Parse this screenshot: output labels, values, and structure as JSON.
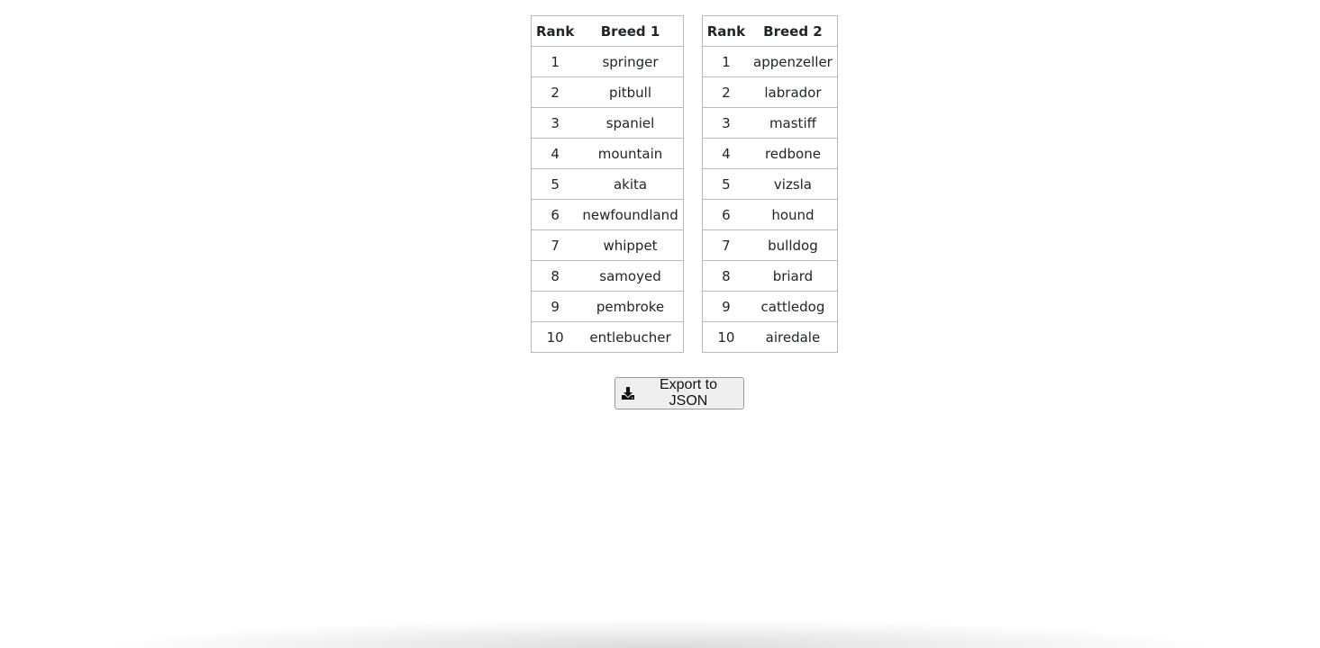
{
  "table1": {
    "headers": {
      "rank": "Rank",
      "breed": "Breed 1"
    },
    "rows": [
      {
        "rank": "1",
        "breed": "springer"
      },
      {
        "rank": "2",
        "breed": "pitbull"
      },
      {
        "rank": "3",
        "breed": "spaniel"
      },
      {
        "rank": "4",
        "breed": "mountain"
      },
      {
        "rank": "5",
        "breed": "akita"
      },
      {
        "rank": "6",
        "breed": "newfoundland"
      },
      {
        "rank": "7",
        "breed": "whippet"
      },
      {
        "rank": "8",
        "breed": "samoyed"
      },
      {
        "rank": "9",
        "breed": "pembroke"
      },
      {
        "rank": "10",
        "breed": "entlebucher"
      }
    ]
  },
  "table2": {
    "headers": {
      "rank": "Rank",
      "breed": "Breed 2"
    },
    "rows": [
      {
        "rank": "1",
        "breed": "appenzeller"
      },
      {
        "rank": "2",
        "breed": "labrador"
      },
      {
        "rank": "3",
        "breed": "mastiff"
      },
      {
        "rank": "4",
        "breed": "redbone"
      },
      {
        "rank": "5",
        "breed": "vizsla"
      },
      {
        "rank": "6",
        "breed": "hound"
      },
      {
        "rank": "7",
        "breed": "bulldog"
      },
      {
        "rank": "8",
        "breed": "briard"
      },
      {
        "rank": "9",
        "breed": "cattledog"
      },
      {
        "rank": "10",
        "breed": "airedale"
      }
    ]
  },
  "export": {
    "label": "Export to JSON",
    "icon": "download-icon"
  }
}
